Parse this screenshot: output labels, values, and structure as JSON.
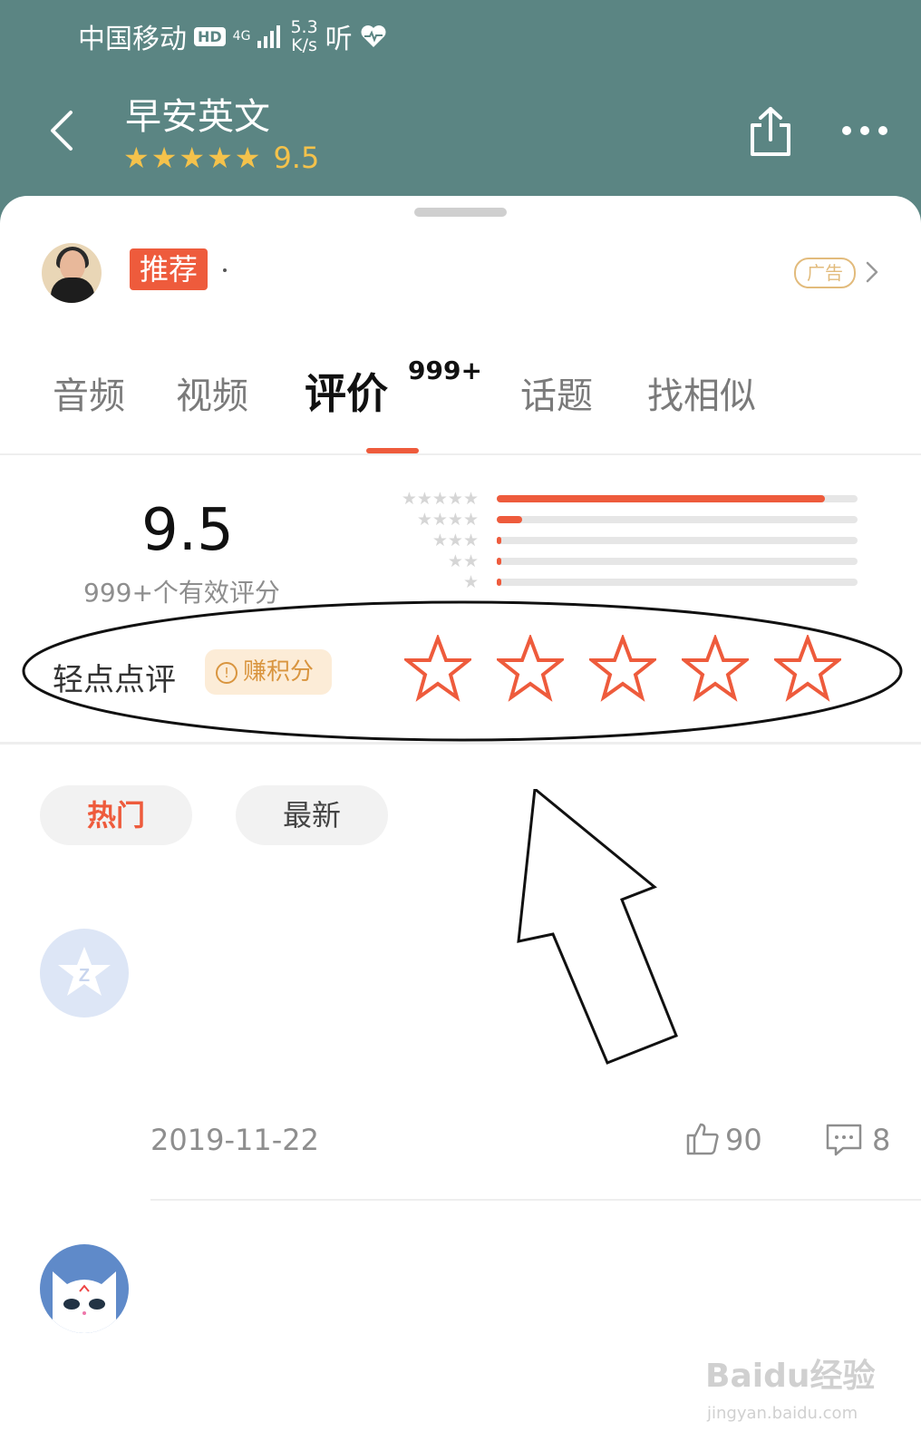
{
  "status_bar": {
    "carrier": "中国移动",
    "hd": "HD",
    "network": "4G",
    "speed_value": "5.3",
    "speed_unit": "K/s",
    "listen": "听"
  },
  "header": {
    "title": "早安英文",
    "stars": [
      "★",
      "★",
      "★",
      "★",
      "★"
    ],
    "rating": "9.5"
  },
  "promo": {
    "tag": "推荐",
    "ad_label": "广告"
  },
  "tabs": [
    {
      "label": "音频"
    },
    {
      "label": "视频"
    },
    {
      "label": "评价",
      "badge": "999+",
      "active": true
    },
    {
      "label": "话题"
    },
    {
      "label": "找相似"
    }
  ],
  "rating_summary": {
    "score": "9.5",
    "count_text": "999+个有效评分",
    "distribution": [
      {
        "stars": "★★★★★",
        "fraction": 0.91
      },
      {
        "stars": "★★★★",
        "fraction": 0.07
      },
      {
        "stars": "★★★",
        "fraction": 0.012
      },
      {
        "stars": "★★",
        "fraction": 0.008
      },
      {
        "stars": "★",
        "fraction": 0.006
      }
    ]
  },
  "quick_rate": {
    "label": "轻点点评",
    "earn_icon": "!",
    "earn_label": "赚积分",
    "star_count": 5
  },
  "filters": {
    "hot": "热门",
    "latest": "最新"
  },
  "reviews": [
    {
      "date": "2019-11-22",
      "likes": "90",
      "comments": "8"
    }
  ],
  "watermark": {
    "main": "Baidu经验",
    "sub": "jingyan.baidu.com"
  },
  "colors": {
    "header_bg": "#5b8583",
    "accent": "#ee5b3c",
    "star_gold": "#f4c24b"
  }
}
